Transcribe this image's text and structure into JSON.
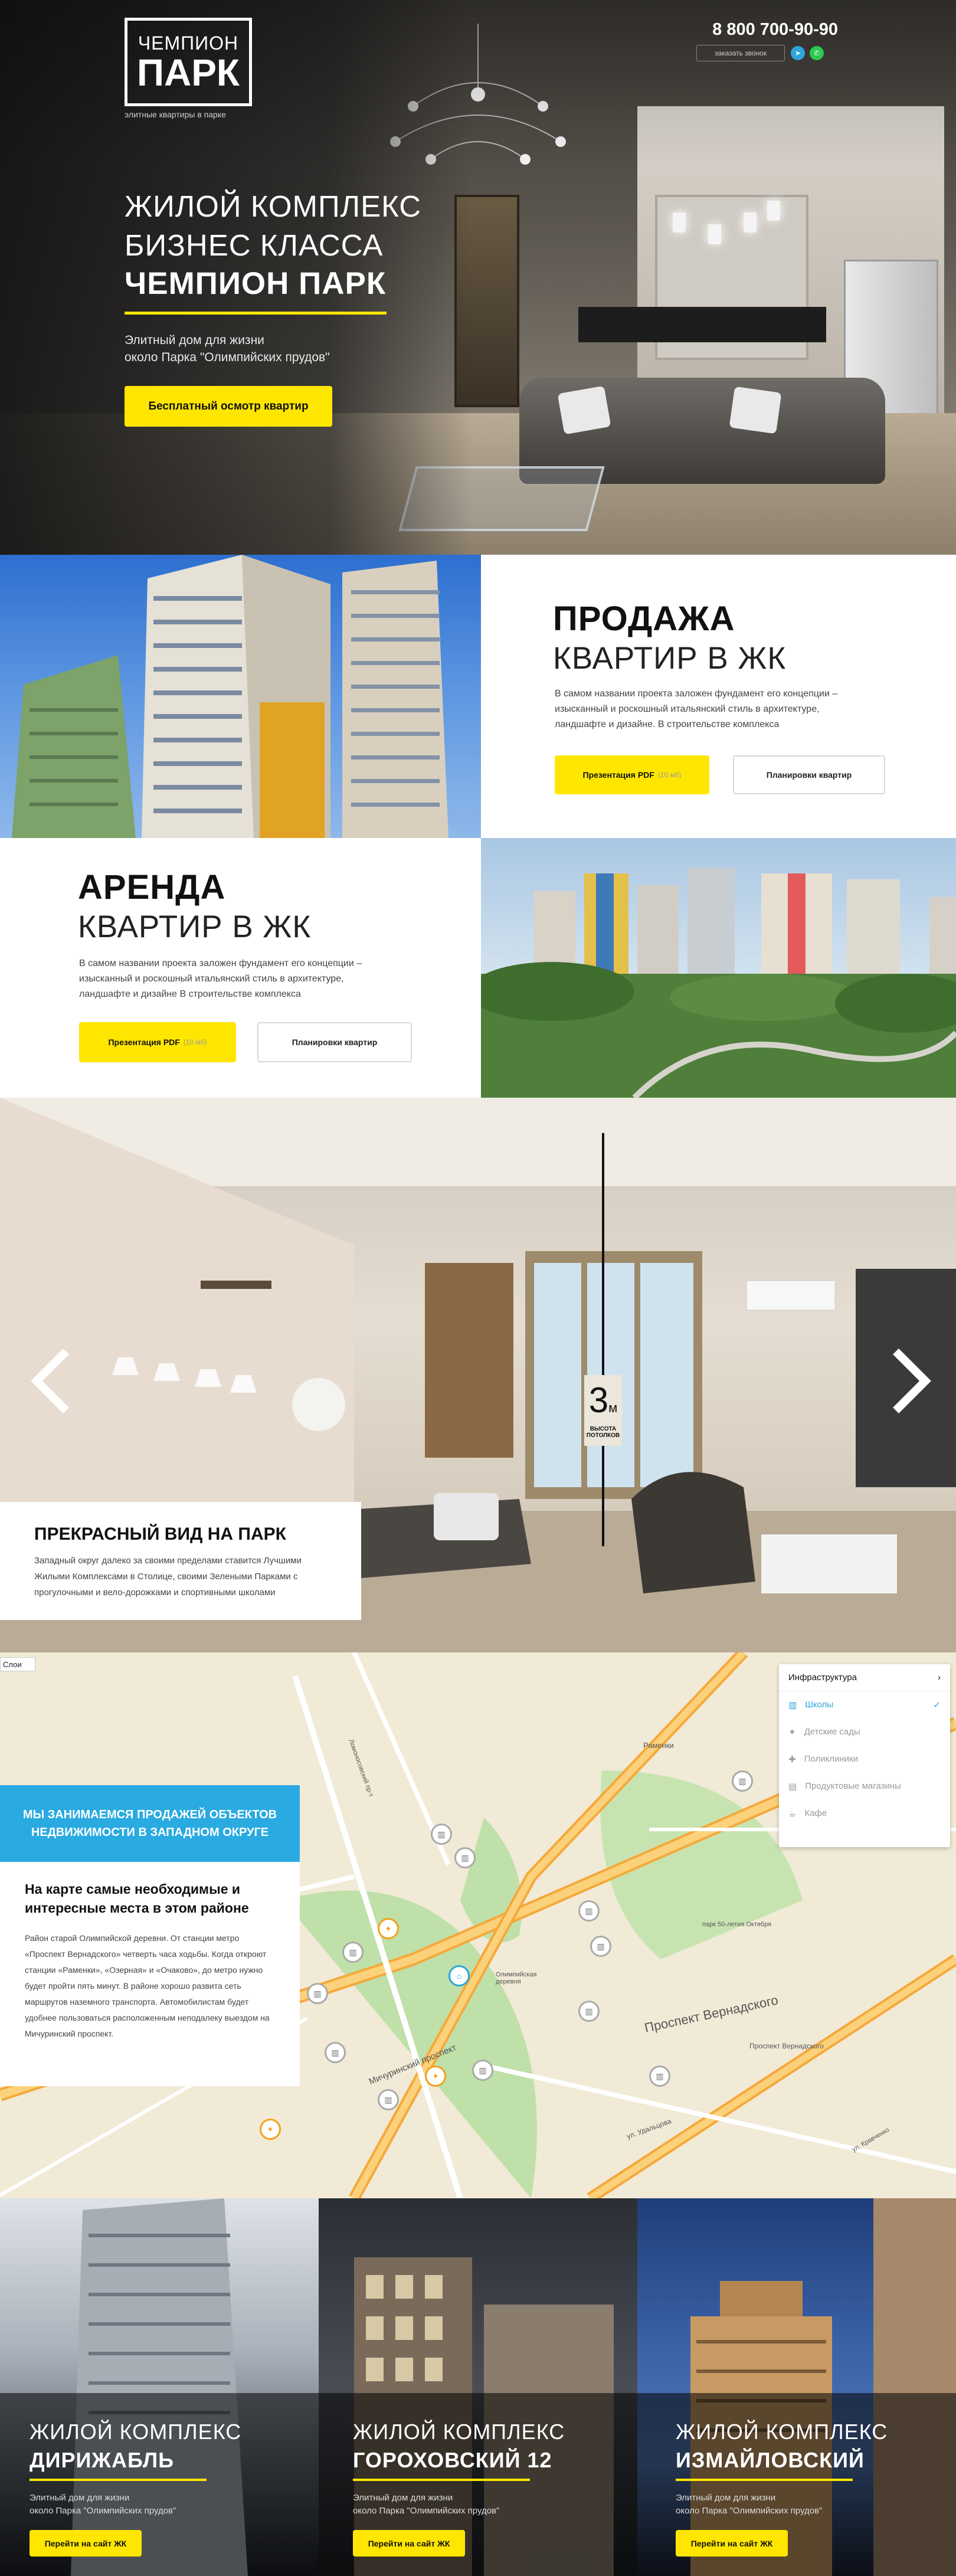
{
  "brand": {
    "logo_line1": "ЧЕМПИОН",
    "logo_line2": "ПАРК",
    "tagline": "элитные квартиры в парке"
  },
  "header": {
    "phone": "8 800 700-90-90",
    "callback": "заказать звонок",
    "icons": [
      "telegram-icon",
      "whatsapp-icon"
    ]
  },
  "hero": {
    "title_line1": "ЖИЛОЙ КОМПЛЕКС",
    "title_line2": "БИЗНЕС КЛАССА",
    "title_line3": "ЧЕМПИОН ПАРК",
    "subtitle_line1": "Элитный дом для жизни",
    "subtitle_line2": "около Парка \"Олимпийских прудов\"",
    "cta": "Бесплатный осмотр квартир"
  },
  "sale": {
    "title": "ПРОДАЖА",
    "subtitle": "КВАРТИР В ЖК",
    "text": "В самом названии проекта заложен фундамент его концепции – изысканный и роскошный итальянский стиль в архитектуре, ландшафте и дизайне. В строительстве комплекса",
    "btn_pdf": "Презентация  PDF",
    "btn_pdf_size": "(10 мб)",
    "btn_plans": "Планировки квартир"
  },
  "rent": {
    "title": "АРЕНДА",
    "subtitle": "КВАРТИР В ЖК",
    "text": "В самом названии проекта заложен фундамент его концепции – изысканный и роскошный итальянский стиль в архитектуре, ландшафте и дизайне  В строительстве комплекса",
    "btn_pdf": "Презентация  PDF",
    "btn_pdf_size": "(10 мб)",
    "btn_plans": "Планировки квартир"
  },
  "room": {
    "ceiling_value": "3",
    "ceiling_unit": "м",
    "ceiling_label1": "ВЫСОТА",
    "ceiling_label2": "ПОТОЛКОВ",
    "caption_title": "ПРЕКРАСНЫЙ ВИД НА ПАРК",
    "caption_text": "Западный округ далеко за своими пределами ставится Лучшими Жилыми Комплексами в Столице, своими Зелеными Парками с прогулочными и вело-дорожками и спортивными школами"
  },
  "map": {
    "layer_select": "Слои",
    "blue_banner": "МЫ ЗАНИМАЕМСЯ ПРОДАЖЕЙ ОБЪЕКТОВ НЕДВИЖИМОСТИ В ЗАПАДНОМ ОКРУГЕ",
    "card_title": "На карте самые необходимые и интересные места в этом районе",
    "card_text": "Район старой Олимпийской деревни. От станции метро «Проспект Вернадского» четверть часа ходьбы. Когда откроют станции «Раменки», «Озерная» и «Очаково», до метро нужно будет пройти пять минут. В районе хорошо развита сеть маршрутов наземного транспорта. Автомобилистам будет удобнее пользоваться расположенным неподалеку выездом на Мичуринский проспект.",
    "infra_title": "Инфраструктура",
    "infra_items": [
      {
        "label": "Школы",
        "icon": "school-icon",
        "active": true
      },
      {
        "label": "Детские сады",
        "icon": "kindergarten-icon",
        "active": false
      },
      {
        "label": "Поликлиники",
        "icon": "clinic-icon",
        "active": false
      },
      {
        "label": "Продуктовые магазины",
        "icon": "shop-icon",
        "active": false
      },
      {
        "label": "Кафе",
        "icon": "cafe-icon",
        "active": false
      }
    ],
    "street_labels": [
      "Мичуринский проспект",
      "Проспект Вернадского",
      "Ломоносовский пр-т",
      "Раменки",
      "парк 50-летия Октября",
      "Олимпийская деревня",
      "ул. Удальцова",
      "ул. Кравченко",
      "Проспект Вернадского"
    ]
  },
  "projects": [
    {
      "title1": "ЖИЛОЙ КОМПЛЕКС",
      "title2": "ДИРИЖАБЛЬ",
      "text1": "Элитный дом для жизни",
      "text2": "около Парка \"Олимпийских прудов\"",
      "btn": "Перейти на сайт ЖК"
    },
    {
      "title1": "ЖИЛОЙ КОМПЛЕКС",
      "title2": "ГОРОХОВСКИЙ 12",
      "text1": "Элитный дом для жизни",
      "text2": "около Парка \"Олимпийских прудов\"",
      "btn": "Перейти на сайт ЖК"
    },
    {
      "title1": "ЖИЛОЙ КОМПЛЕКС",
      "title2": "ИЗМАЙЛОВСКИЙ",
      "text1": "Элитный дом для жизни",
      "text2": "около Парка \"Олимпийских прудов\"",
      "btn": "Перейти на сайт ЖК"
    }
  ],
  "colors": {
    "accent": "#ffe600",
    "blue": "#29aae1",
    "dark": "#111111"
  }
}
